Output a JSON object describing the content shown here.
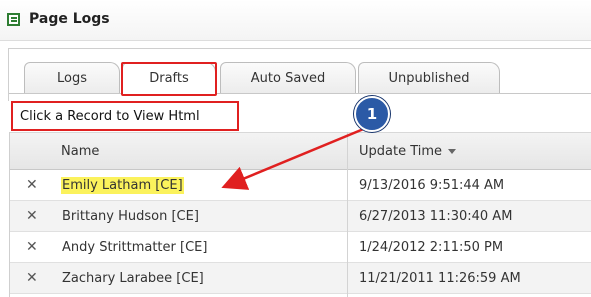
{
  "window": {
    "title": "Page Logs"
  },
  "tabs": [
    {
      "label": "Logs"
    },
    {
      "label": "Drafts",
      "selected": true
    },
    {
      "label": "Auto Saved"
    },
    {
      "label": "Unpublished"
    }
  ],
  "instruction": "Click a Record to View Html",
  "callout": {
    "number": "1"
  },
  "grid": {
    "columns": {
      "name": "Name",
      "update_time": "Update Time"
    },
    "sort": "descending",
    "rows": [
      {
        "name": "Emily Latham [CE]",
        "update_time": "9/13/2016 9:51:44 AM",
        "highlighted": true
      },
      {
        "name": "Brittany Hudson [CE]",
        "update_time": "6/27/2013 11:30:40 AM"
      },
      {
        "name": "Andy Strittmatter [CE]",
        "update_time": "1/24/2012 2:11:50 PM"
      },
      {
        "name": "Zachary Larabee [CE]",
        "update_time": "11/21/2011 11:26:59 AM"
      }
    ]
  },
  "icons": {
    "title": "page-logs-icon",
    "delete": "close-icon",
    "sort": "sort-descending-icon"
  },
  "colors": {
    "annotation_red": "#e02020",
    "callout_blue": "#2b5aa6",
    "highlight_yellow": "#fbf25c"
  }
}
